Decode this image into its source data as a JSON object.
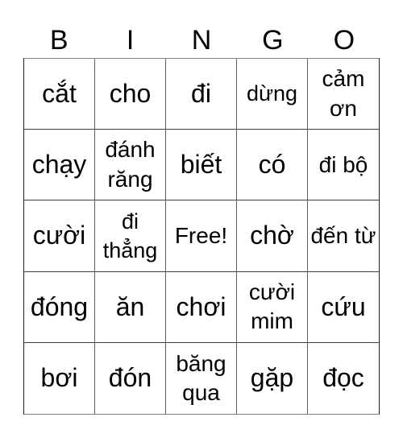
{
  "header": {
    "letters": [
      "B",
      "I",
      "N",
      "G",
      "O"
    ]
  },
  "grid": {
    "rows": [
      [
        "cắt",
        "cho",
        "đi",
        "dừng",
        "cảm ơn"
      ],
      [
        "chạy",
        "đánh răng",
        "biết",
        "có",
        "đi bộ"
      ],
      [
        "cười",
        "đi thẳng",
        "Free!",
        "chờ",
        "đến từ"
      ],
      [
        "đóng",
        "ăn",
        "chơi",
        "cười mim",
        "cứu"
      ],
      [
        "bơi",
        "đón",
        "băng qua",
        "gặp",
        "đọc"
      ]
    ]
  },
  "colors": {
    "background": "#ffffff",
    "text": "#000000",
    "grid_line": "#404040"
  }
}
